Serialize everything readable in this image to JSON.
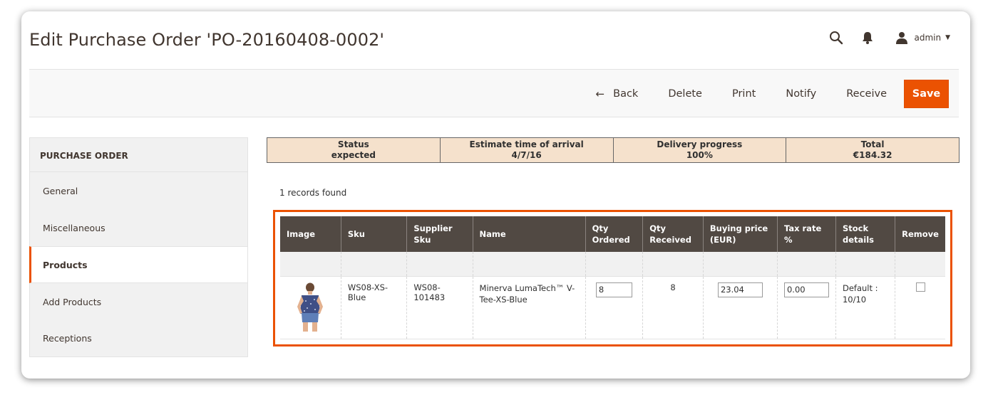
{
  "header": {
    "title": "Edit Purchase Order 'PO-20160408-0002'",
    "user": "admin",
    "icons": [
      "search-icon",
      "bell-icon",
      "user-icon"
    ]
  },
  "toolbar": {
    "back_label": "Back",
    "delete_label": "Delete",
    "print_label": "Print",
    "notify_label": "Notify",
    "receive_label": "Receive",
    "save_label": "Save"
  },
  "sidebar": {
    "heading": "PURCHASE ORDER",
    "items": [
      {
        "label": "General"
      },
      {
        "label": "Miscellaneous"
      },
      {
        "label": "Products"
      },
      {
        "label": "Add Products"
      },
      {
        "label": "Receptions"
      }
    ]
  },
  "summary": [
    {
      "label": "Status",
      "value": "expected"
    },
    {
      "label": "Estimate time of arrival",
      "value": "4/7/16"
    },
    {
      "label": "Delivery progress",
      "value": "100%"
    },
    {
      "label": "Total",
      "value": "€184.32"
    }
  ],
  "records_text": "1 records found",
  "grid": {
    "columns": [
      "Image",
      "Sku",
      "Supplier Sku",
      "Name",
      "Qty Ordered",
      "Qty Received",
      "Buying price (EUR)",
      "Tax rate %",
      "Stock details",
      "Remove"
    ],
    "rows": [
      {
        "sku": "WS08-XS-Blue",
        "supplier_sku": "WS08-101483",
        "name": "Minerva LumaTech™ V-Tee-XS-Blue",
        "qty_ordered": "8",
        "qty_received": "8",
        "buying_price": "23.04",
        "tax_rate": "0.00",
        "stock_details": "Default : 10/10"
      }
    ]
  },
  "colors": {
    "accent": "#eb5202",
    "grid_header": "#514943",
    "summary_bg": "#f5e1cc"
  }
}
